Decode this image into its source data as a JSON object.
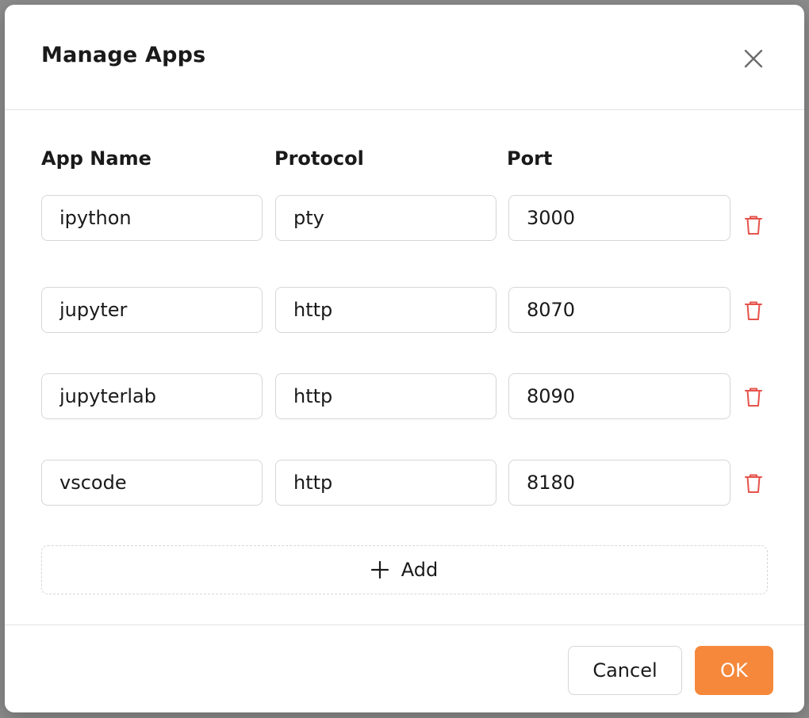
{
  "modal": {
    "title": "Manage Apps"
  },
  "columns": {
    "app_name": "App Name",
    "protocol": "Protocol",
    "port": "Port"
  },
  "apps": [
    {
      "name": "ipython",
      "protocol": "pty",
      "port": "3000"
    },
    {
      "name": "jupyter",
      "protocol": "http",
      "port": "8070"
    },
    {
      "name": "jupyterlab",
      "protocol": "http",
      "port": "8090"
    },
    {
      "name": "vscode",
      "protocol": "http",
      "port": "8180"
    }
  ],
  "add_button": {
    "label": "Add",
    "icon": "plus-icon"
  },
  "footer": {
    "cancel_label": "Cancel",
    "ok_label": "OK"
  },
  "icons": {
    "close": "close-icon",
    "delete": "trash-icon"
  },
  "colors": {
    "primary": "#f5883a",
    "danger": "#e5534b",
    "border": "#d6d6d6"
  }
}
